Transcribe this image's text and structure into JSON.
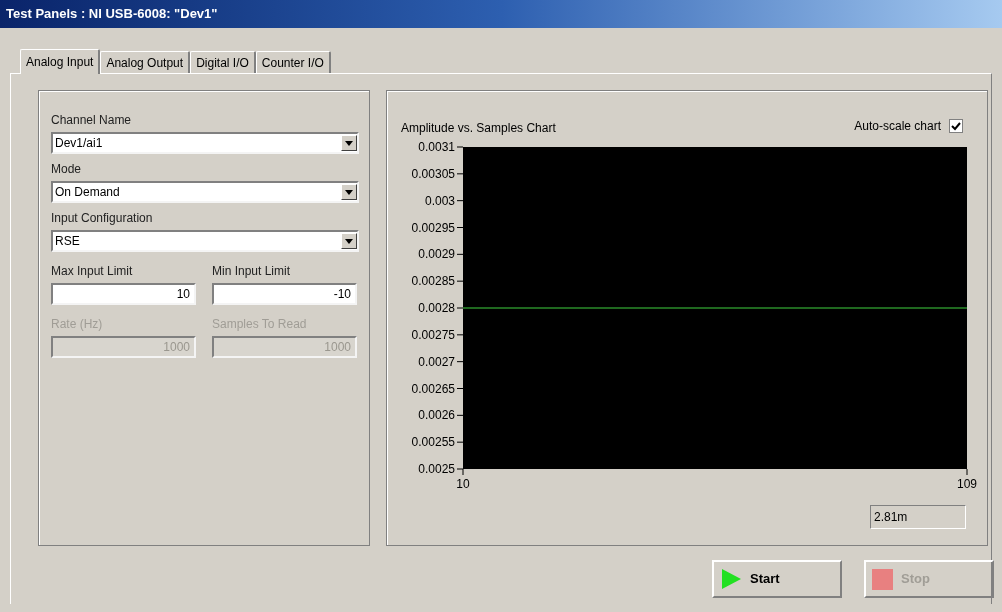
{
  "window": {
    "title": "Test Panels : NI USB-6008: \"Dev1\""
  },
  "tabs": [
    {
      "label": "Analog Input",
      "selected": true
    },
    {
      "label": "Analog Output",
      "selected": false
    },
    {
      "label": "Digital I/O",
      "selected": false
    },
    {
      "label": "Counter I/O",
      "selected": false
    }
  ],
  "settings": {
    "dropdowns": [
      {
        "label": "Channel Name",
        "value": "Dev1/ai1"
      },
      {
        "label": "Mode",
        "value": "On Demand"
      },
      {
        "label": "Input Configuration",
        "value": "RSE"
      }
    ],
    "numeric_rows": [
      [
        {
          "label": "Max Input Limit",
          "value": "10",
          "disabled": false
        },
        {
          "label": "Min Input Limit",
          "value": "-10",
          "disabled": false
        }
      ],
      [
        {
          "label": "Rate (Hz)",
          "value": "1000",
          "disabled": true
        },
        {
          "label": "Samples To Read",
          "value": "1000",
          "disabled": true
        }
      ]
    ]
  },
  "chart_panel": {
    "auto_scale": {
      "label": "Auto-scale chart",
      "checked": true
    },
    "chart_data": {
      "type": "line",
      "title": "Amplitude vs. Samples Chart",
      "x": [
        10,
        109
      ],
      "values": [
        0.0028,
        0.0028
      ],
      "xlim": [
        10,
        109
      ],
      "ylim": [
        0.0025,
        0.0031
      ],
      "xticks": [
        10,
        109
      ],
      "yticks": [
        0.0031,
        0.00305,
        0.003,
        0.00295,
        0.0029,
        0.00285,
        0.0028,
        0.00275,
        0.0027,
        0.00265,
        0.0026,
        0.00255,
        0.0025
      ]
    },
    "readout": "2.81m"
  },
  "buttons": [
    {
      "kind": "start",
      "label": "Start",
      "disabled": false
    },
    {
      "kind": "stop",
      "label": "Stop",
      "disabled": true
    }
  ]
}
